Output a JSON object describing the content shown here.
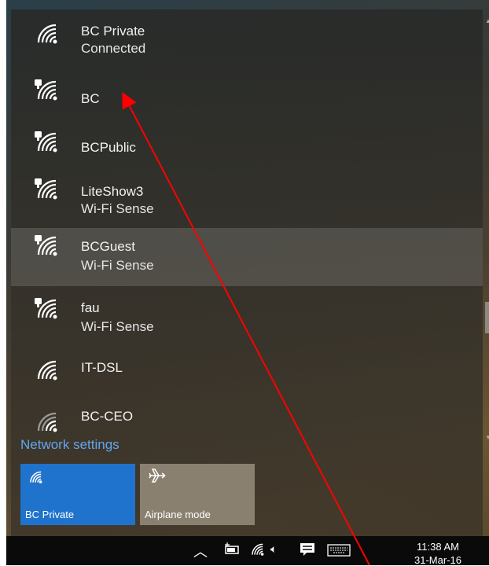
{
  "networks": [
    {
      "name": "BC Private",
      "status": "Connected",
      "icon": "wifi-icon",
      "secured": false
    },
    {
      "name": "BC",
      "status": "",
      "icon": "wifi-secured-icon",
      "secured": true
    },
    {
      "name": "BCPublic",
      "status": "",
      "icon": "wifi-secured-icon",
      "secured": true
    },
    {
      "name": "LiteShow3",
      "status": "Wi-Fi Sense",
      "icon": "wifi-secured-icon",
      "secured": true
    },
    {
      "name": "BCGuest",
      "status": "Wi-Fi Sense",
      "icon": "wifi-secured-icon",
      "secured": true
    },
    {
      "name": "fau",
      "status": "Wi-Fi Sense",
      "icon": "wifi-secured-icon",
      "secured": true
    },
    {
      "name": "IT-DSL",
      "status": "",
      "icon": "wifi-icon",
      "secured": false
    },
    {
      "name": "BC-CEO",
      "status": "",
      "icon": "wifi-weak-icon",
      "secured": false
    }
  ],
  "network_settings_label": "Network settings",
  "tiles": {
    "wifi": {
      "label": "BC Private",
      "icon": "wifi-icon"
    },
    "airplane": {
      "label": "Airplane mode",
      "icon": "airplane-icon"
    }
  },
  "taskbar": {
    "time": "11:38 AM",
    "date": "31-Mar-16",
    "icons": [
      "chevron-up-icon",
      "battery-icon",
      "wifi-icon",
      "volume-icon",
      "action-center-icon",
      "keyboard-icon"
    ]
  },
  "colors": {
    "accent": "#1f73cc",
    "link": "#62a6ee",
    "annotation_arrow": "#ff0000"
  }
}
